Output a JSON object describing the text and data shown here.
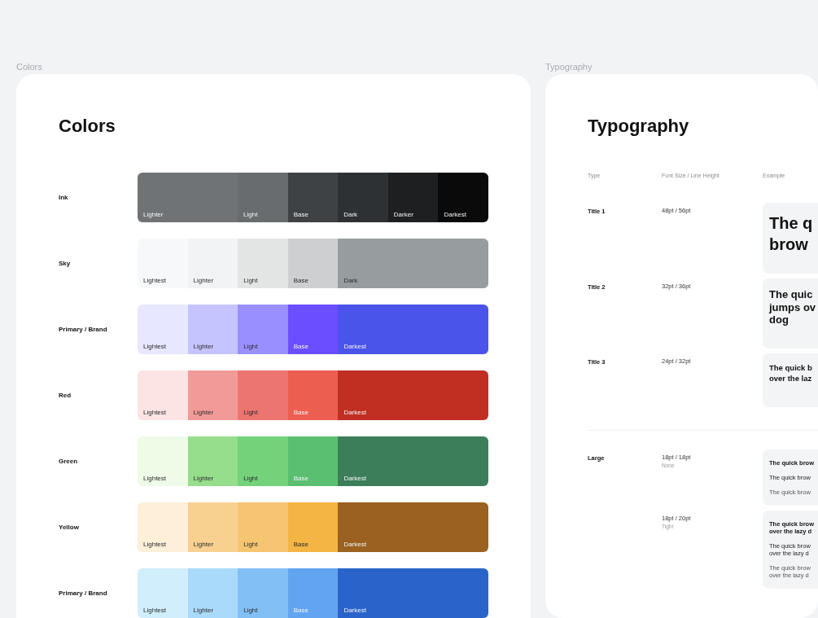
{
  "colors_frame": {
    "label": "Colors",
    "title": "Colors",
    "palettes": [
      {
        "name": "Ink",
        "swatches": [
          {
            "label": "Lighter",
            "color": "#707376",
            "wide": true,
            "label_on_dark": true
          },
          {
            "label": "Light",
            "color": "#686c6e",
            "wide": false,
            "label_on_dark": true
          },
          {
            "label": "Base",
            "color": "#3f4244",
            "wide": false,
            "label_on_dark": true
          },
          {
            "label": "Dark",
            "color": "#2e3134",
            "wide": false,
            "label_on_dark": true
          },
          {
            "label": "Darker",
            "color": "#1d1f21",
            "wide": false,
            "label_on_dark": true
          },
          {
            "label": "Darkest",
            "color": "#0a0a0a",
            "wide": false,
            "label_on_dark": true
          }
        ]
      },
      {
        "name": "Sky",
        "swatches": [
          {
            "label": "Lightest",
            "color": "#f7f8f9",
            "wide": false,
            "label_on_dark": false
          },
          {
            "label": "Lighter",
            "color": "#f2f3f4",
            "wide": false,
            "label_on_dark": false
          },
          {
            "label": "Light",
            "color": "#e3e5e5",
            "wide": false,
            "label_on_dark": false
          },
          {
            "label": "Base",
            "color": "#cdcfd0",
            "wide": false,
            "label_on_dark": false
          },
          {
            "label": "Dark",
            "color": "#979c9e",
            "wide": true,
            "label_on_dark": false
          }
        ]
      },
      {
        "name": "Primary / Brand",
        "swatches": [
          {
            "label": "Lightest",
            "color": "#e7e7ff",
            "wide": false,
            "label_on_dark": false
          },
          {
            "label": "Lighter",
            "color": "#c6c4ff",
            "wide": false,
            "label_on_dark": false
          },
          {
            "label": "Light",
            "color": "#9990ff",
            "wide": false,
            "label_on_dark": false
          },
          {
            "label": "Base",
            "color": "#6b4eff",
            "wide": false,
            "label_on_dark": true
          },
          {
            "label": "Darkest",
            "color": "#4a54eb",
            "wide": true,
            "label_on_dark": true
          }
        ]
      },
      {
        "name": "Red",
        "swatches": [
          {
            "label": "Lightest",
            "color": "#fce4e4",
            "wide": false,
            "label_on_dark": false
          },
          {
            "label": "Lighter",
            "color": "#f29a97",
            "wide": false,
            "label_on_dark": false
          },
          {
            "label": "Light",
            "color": "#ec7570",
            "wide": false,
            "label_on_dark": false
          },
          {
            "label": "Base",
            "color": "#ec5e4f",
            "wide": false,
            "label_on_dark": true
          },
          {
            "label": "Darkest",
            "color": "#c02f22",
            "wide": true,
            "label_on_dark": true
          }
        ]
      },
      {
        "name": "Green",
        "swatches": [
          {
            "label": "Lightest",
            "color": "#eefbe7",
            "wide": false,
            "label_on_dark": false
          },
          {
            "label": "Lighter",
            "color": "#96dd8c",
            "wide": false,
            "label_on_dark": false
          },
          {
            "label": "Light",
            "color": "#74d27a",
            "wide": false,
            "label_on_dark": false
          },
          {
            "label": "Base",
            "color": "#5bbf72",
            "wide": false,
            "label_on_dark": true
          },
          {
            "label": "Darkest",
            "color": "#3c7e5a",
            "wide": true,
            "label_on_dark": true
          }
        ]
      },
      {
        "name": "Yellow",
        "swatches": [
          {
            "label": "Lightest",
            "color": "#fdefd8",
            "wide": false,
            "label_on_dark": false
          },
          {
            "label": "Lighter",
            "color": "#f8d191",
            "wide": false,
            "label_on_dark": false
          },
          {
            "label": "Light",
            "color": "#f5c571",
            "wide": false,
            "label_on_dark": false
          },
          {
            "label": "Base",
            "color": "#f4b544",
            "wide": false,
            "label_on_dark": false
          },
          {
            "label": "Darkest",
            "color": "#9a6120",
            "wide": true,
            "label_on_dark": true
          }
        ]
      },
      {
        "name": "Primary / Brand",
        "swatches": [
          {
            "label": "Lightest",
            "color": "#d1eefc",
            "wide": false,
            "label_on_dark": false
          },
          {
            "label": "Lighter",
            "color": "#a9dafb",
            "wide": false,
            "label_on_dark": false
          },
          {
            "label": "Light",
            "color": "#82bff5",
            "wide": false,
            "label_on_dark": false
          },
          {
            "label": "Base",
            "color": "#62a4ef",
            "wide": false,
            "label_on_dark": true
          },
          {
            "label": "Darkest",
            "color": "#2a64cb",
            "wide": true,
            "label_on_dark": true
          }
        ]
      }
    ]
  },
  "typography_frame": {
    "label": "Typography",
    "title": "Typography",
    "columns": [
      "Type",
      "Font Size / Line Height",
      "Example"
    ],
    "groups": [
      {
        "rows": [
          {
            "type": "Title 1",
            "size": "48pt / 56pt",
            "kind": "title1",
            "samples": [
              {
                "kind": "bold",
                "lines": [
                  "The q",
                  "brow"
                ]
              }
            ]
          },
          {
            "type": "Title 2",
            "size": "32pt / 36pt",
            "kind": "title2",
            "samples": [
              {
                "kind": "bold",
                "lines": [
                  "The quic",
                  "jumps ov",
                  "dog"
                ]
              }
            ]
          },
          {
            "type": "Title 3",
            "size": "24pt / 32pt",
            "kind": "title3",
            "samples": [
              {
                "kind": "bold",
                "lines": [
                  "The quick b",
                  "over the laz"
                ]
              }
            ]
          }
        ]
      },
      {
        "rows": [
          {
            "type": "Large",
            "size": "18pt / 18pt",
            "hint": "None",
            "kind": "large",
            "samples": [
              {
                "kind": "bold",
                "lines": [
                  "The quick brow"
                ]
              },
              {
                "kind": "medium",
                "lines": [
                  "The quick brow"
                ]
              },
              {
                "kind": "regular",
                "lines": [
                  "The quick brow"
                ]
              }
            ]
          },
          {
            "size": "18pt / 20pt",
            "hint": "Tight",
            "kind": "large",
            "samples": [
              {
                "kind": "bold",
                "lines": [
                  "The quick brow",
                  "over the lazy d"
                ]
              },
              {
                "kind": "medium",
                "lines": [
                  "The quick brow",
                  "over the lazy d"
                ]
              },
              {
                "kind": "regular",
                "lines": [
                  "The quick brow",
                  "over the lazy d"
                ]
              }
            ]
          }
        ]
      }
    ]
  }
}
